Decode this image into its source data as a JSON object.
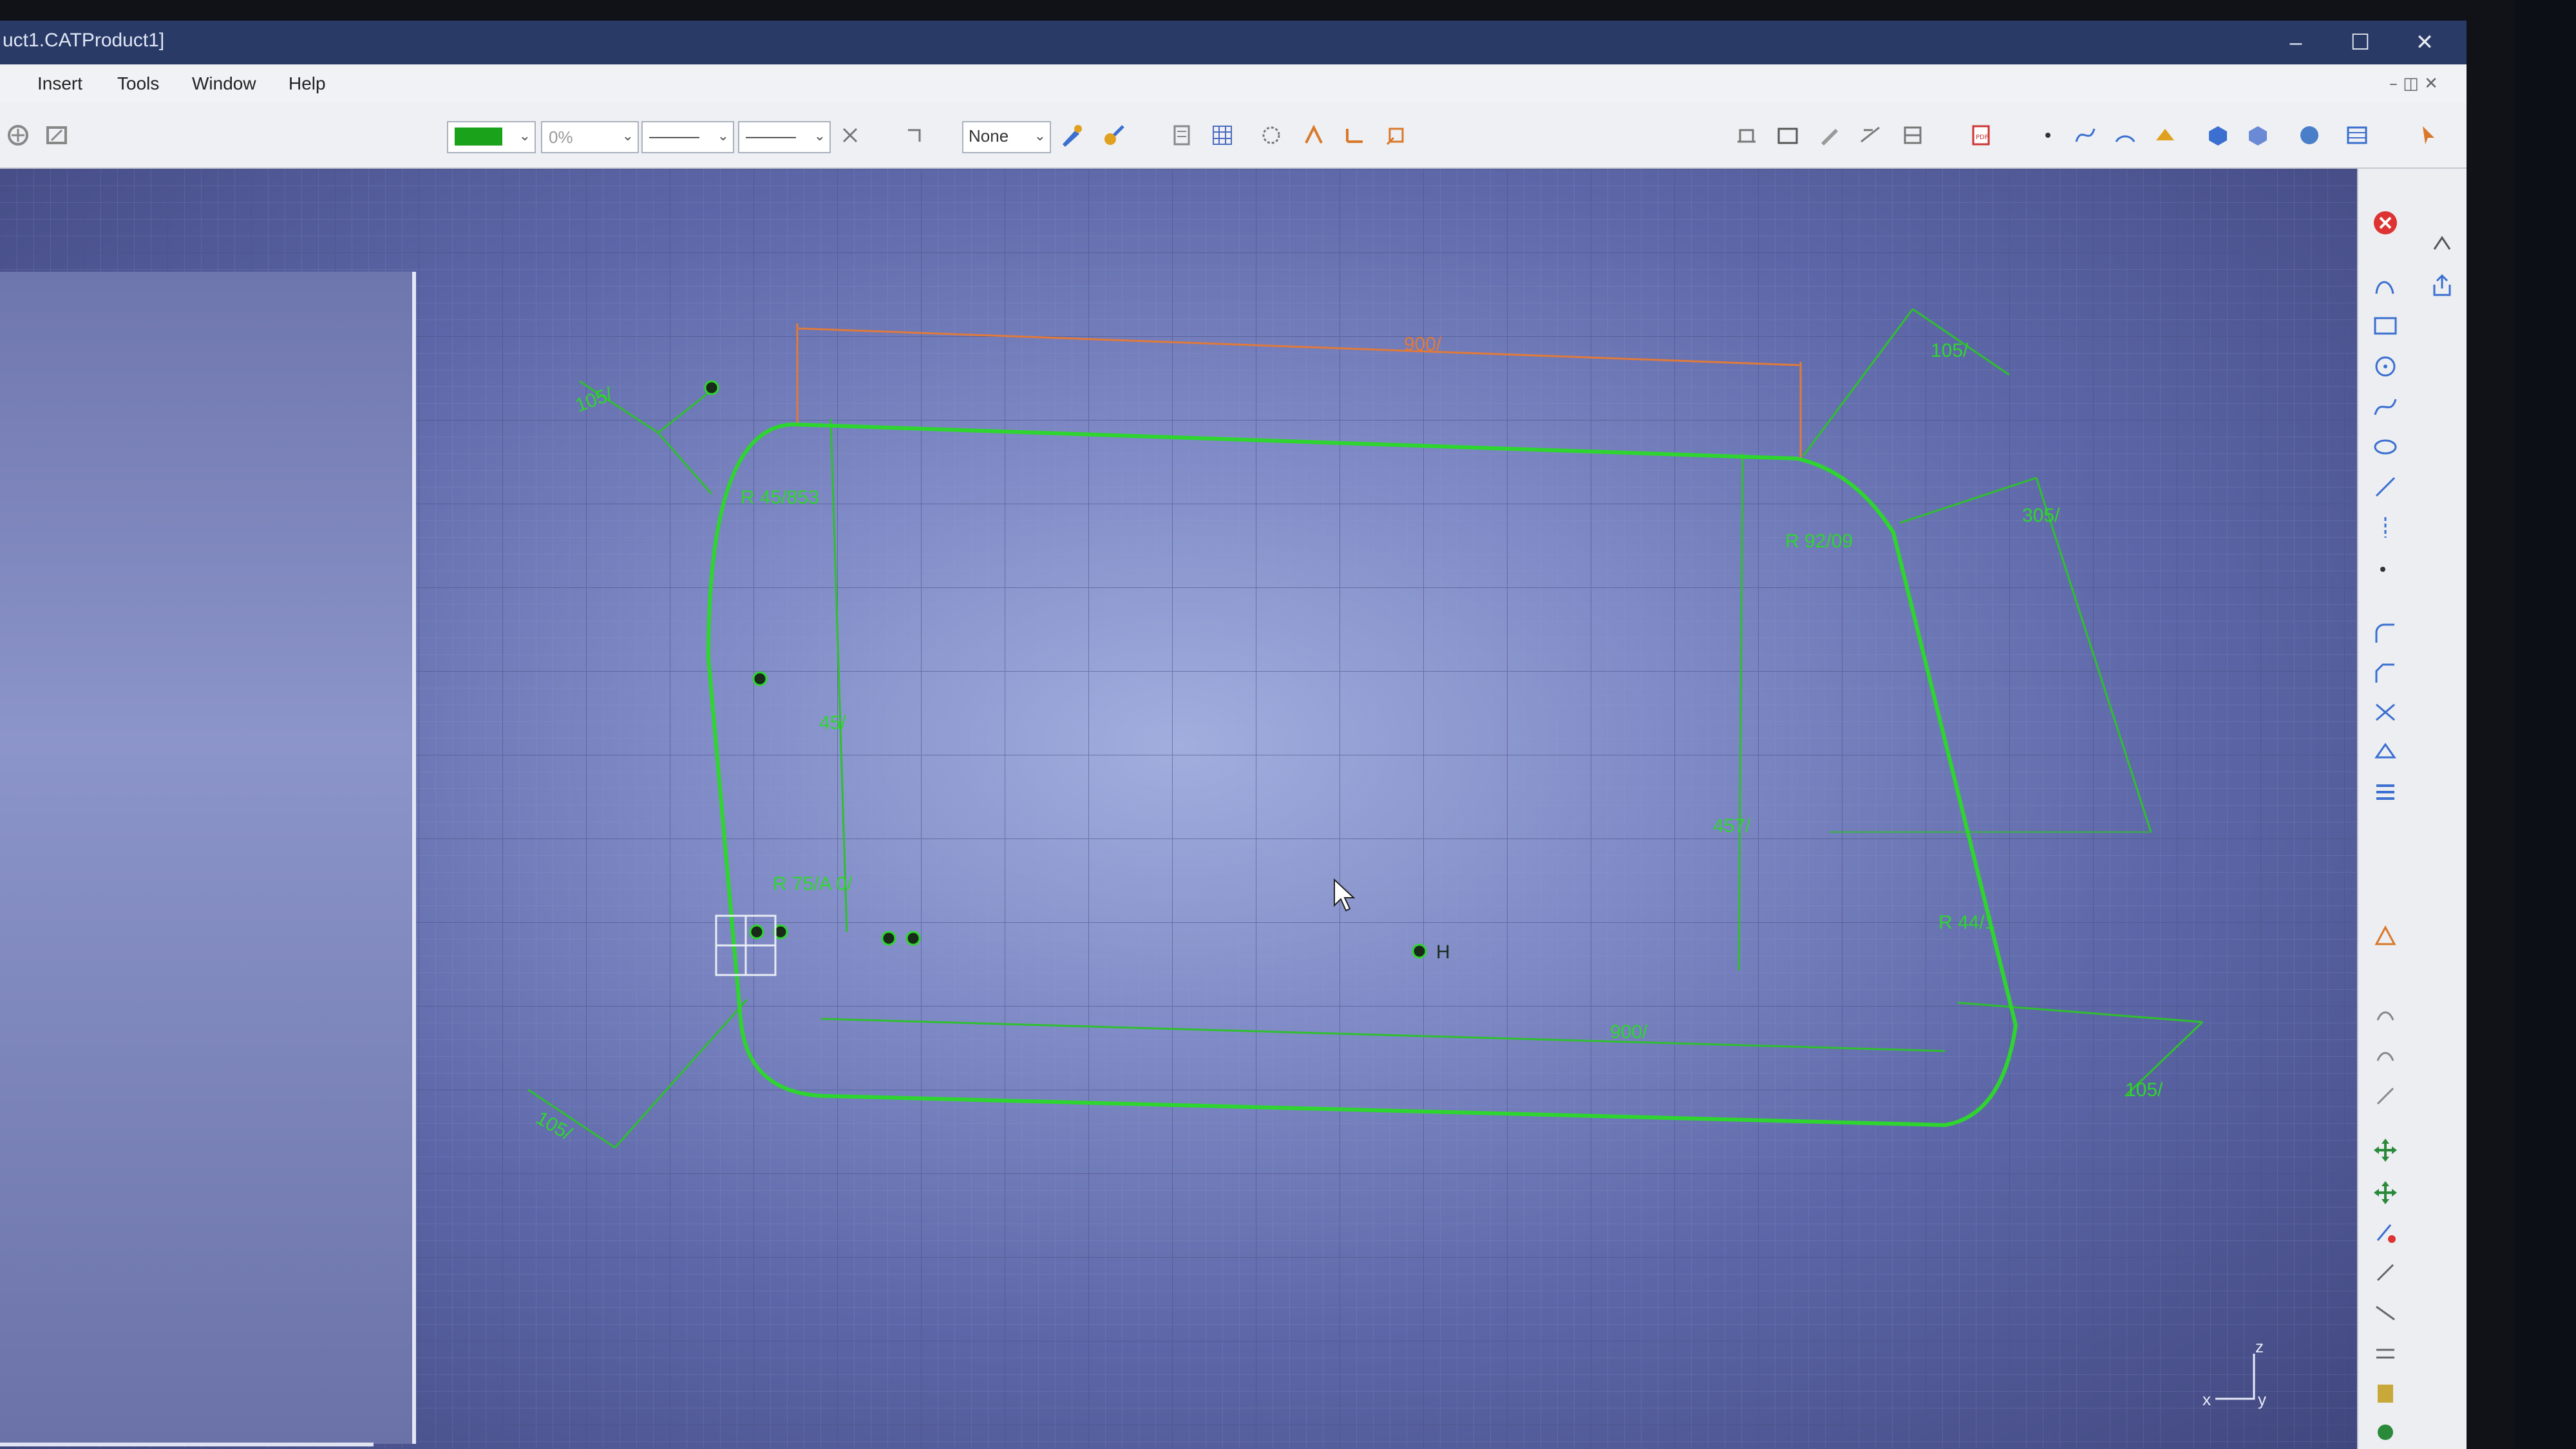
{
  "window": {
    "title": "uct1.CATProduct1]",
    "controls": {
      "minimize": "–",
      "maximize": "☐",
      "close": "✕"
    }
  },
  "menu": {
    "items": [
      "Insert",
      "Tools",
      "Window",
      "Help"
    ]
  },
  "toolbar": {
    "color_swatch": "#1aa31a",
    "transparency_value": "0%",
    "linetype_value": "———",
    "thickness_value": "———",
    "layer_value": "None"
  },
  "sketch": {
    "dimensions": {
      "top_length": "900/",
      "top_left_angle": "105/",
      "top_right_angle": "105/",
      "radius_top_left": "R 45/853",
      "radius_top_right": "R 92/09",
      "left_height": "45/",
      "right_height": "457/",
      "radius_bottom_left": "R 75/A 0/",
      "radius_bottom_right": "R 44/1",
      "bottom_length": "900/",
      "right_side": "305/",
      "bottom_left_angle": "105/",
      "bottom_right_angle": "105/",
      "constraint_h": "H"
    },
    "colors": {
      "profile": "#2fd52f",
      "constraint": "#2fbf2f",
      "active_dimension": "#e07a3a"
    }
  },
  "axis": {
    "z": "z",
    "x": "x",
    "y": "y"
  }
}
